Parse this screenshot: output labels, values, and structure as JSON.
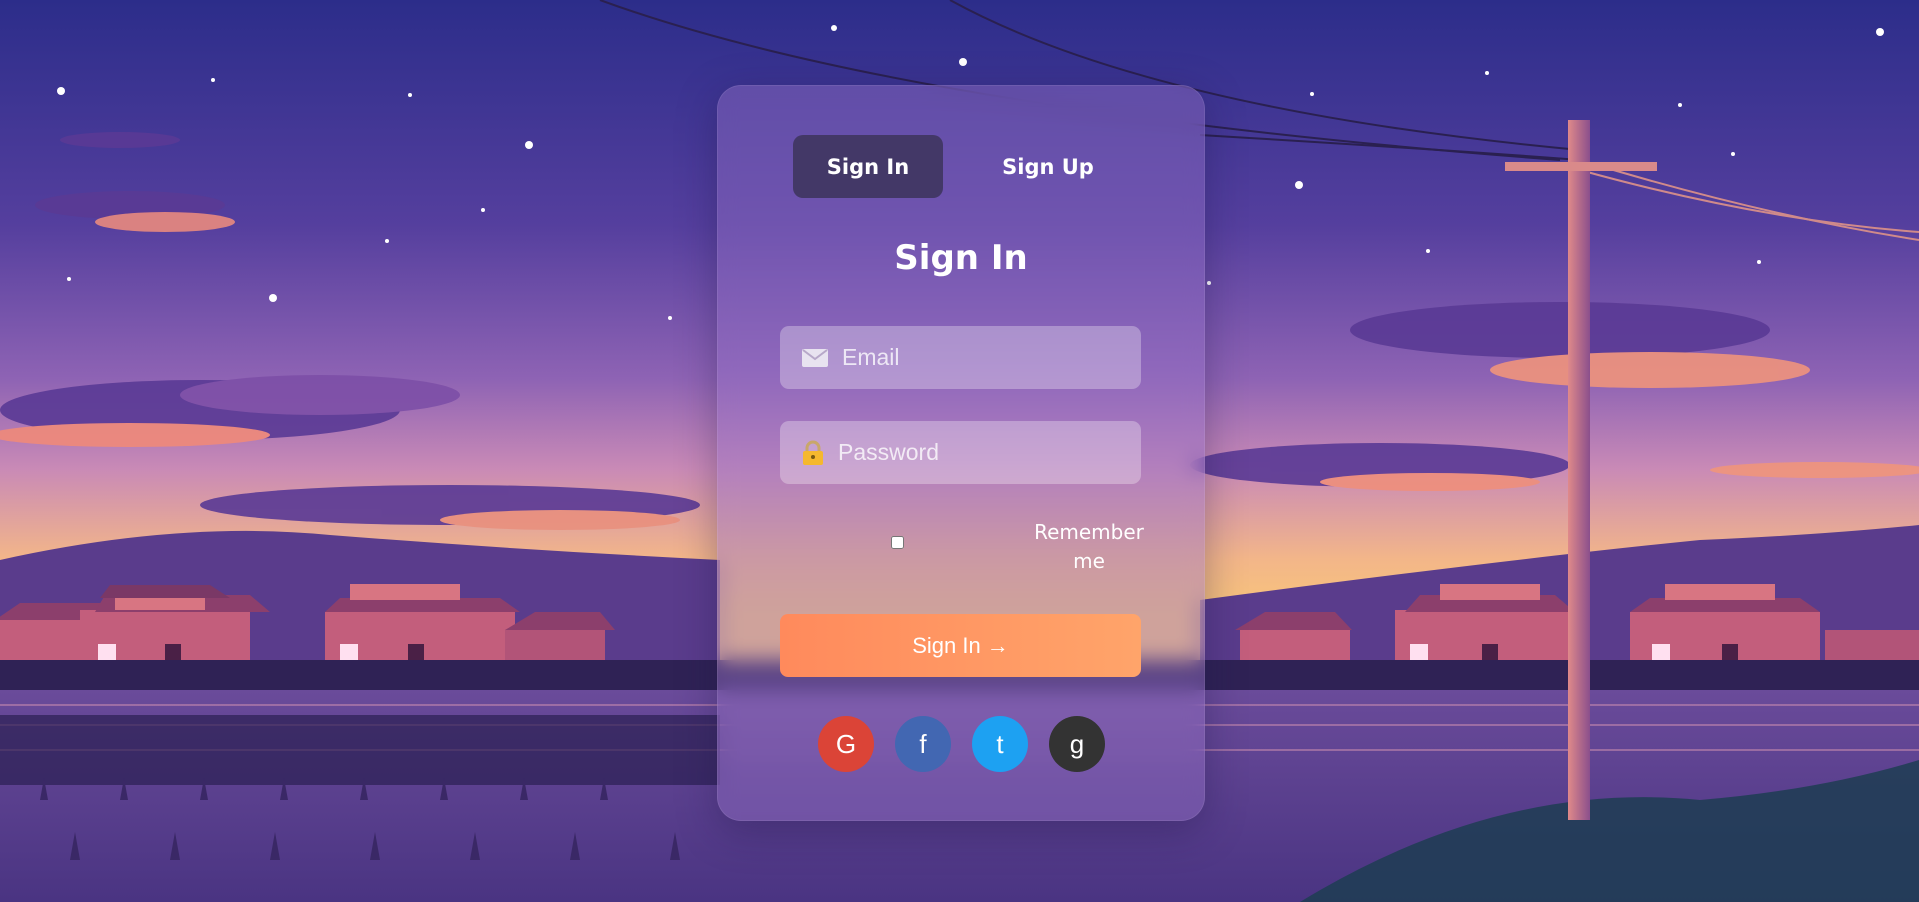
{
  "tabs": [
    {
      "label": "Sign In",
      "active": true
    },
    {
      "label": "Sign Up",
      "active": false
    }
  ],
  "form": {
    "heading": "Sign In",
    "email_placeholder": "Email",
    "password_placeholder": "Password",
    "remember_label": "Remember me",
    "remember_checked": false,
    "submit_label": "Sign In →"
  },
  "social": [
    {
      "label": "G",
      "icon": "google-icon",
      "color": "#db4437"
    },
    {
      "label": "f",
      "icon": "facebook-icon",
      "color": "#4267b2"
    },
    {
      "label": "t",
      "icon": "twitter-icon",
      "color": "#1da1f2"
    },
    {
      "label": "g",
      "icon": "github-icon",
      "color": "#333333"
    }
  ],
  "colors": {
    "active_tab": "#433867",
    "submit_start": "#ff8a5c",
    "submit_end": "#ffa46a",
    "sky_top": "#2c2c8a",
    "horizon": "#f8c078"
  }
}
